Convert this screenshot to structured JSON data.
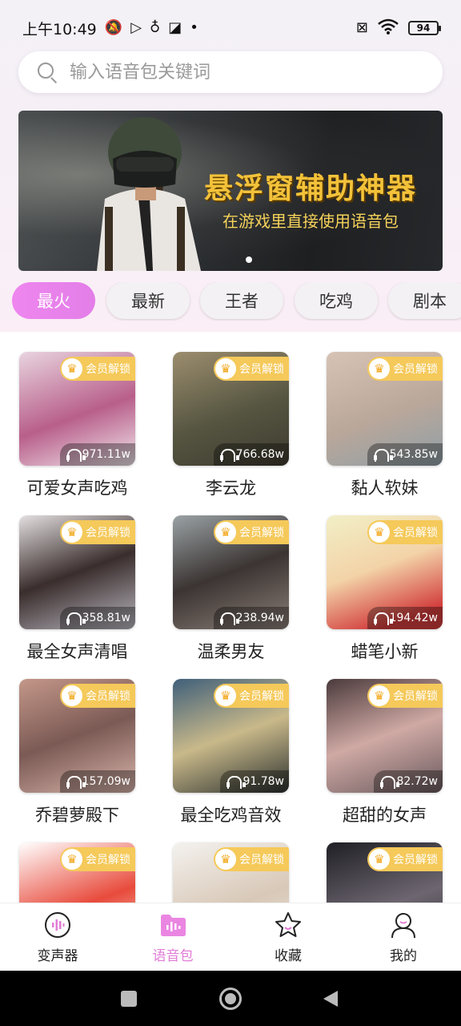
{
  "status_bar": {
    "time": "上午10:49",
    "battery": "94"
  },
  "search": {
    "placeholder": "输入语音包关键词"
  },
  "banner": {
    "title": "悬浮窗辅助神器",
    "subtitle": "在游戏里直接使用语音包"
  },
  "tabs": [
    {
      "label": "最火",
      "active": true
    },
    {
      "label": "最新"
    },
    {
      "label": "王者"
    },
    {
      "label": "吃鸡"
    },
    {
      "label": "剧本"
    }
  ],
  "badge_label": "会员解锁",
  "items": [
    {
      "title": "可爱女声吃鸡",
      "plays": "971.11w",
      "bg": "#d9a4b8"
    },
    {
      "title": "李云龙",
      "plays": "766.68w",
      "bg": "#6b6a55"
    },
    {
      "title": "黏人软妹",
      "plays": "543.85w",
      "bg": "#cdbab0"
    },
    {
      "title": "最全女声清唱",
      "plays": "358.81w",
      "bg": "#c9c4c6"
    },
    {
      "title": "温柔男友",
      "plays": "238.94w",
      "bg": "#8a8580"
    },
    {
      "title": "蜡笔小新",
      "plays": "194.42w",
      "bg": "#e9e5b5"
    },
    {
      "title": "乔碧萝殿下",
      "plays": "157.09w",
      "bg": "#b48b80"
    },
    {
      "title": "最全吃鸡音效",
      "plays": "91.78w",
      "bg": "#4e5a4a"
    },
    {
      "title": "超甜的女声",
      "plays": "82.72w",
      "bg": "#8f7a78"
    },
    {
      "title": "",
      "plays": "",
      "bg": "#e65a4a"
    },
    {
      "title": "",
      "plays": "",
      "bg": "#d9d1c7"
    },
    {
      "title": "",
      "plays": "",
      "bg": "#2a2a2e"
    }
  ],
  "bottom_nav": [
    {
      "label": "变声器",
      "icon": "voice-changer-icon"
    },
    {
      "label": "语音包",
      "icon": "voice-pack-icon",
      "active": true
    },
    {
      "label": "收藏",
      "icon": "star-icon"
    },
    {
      "label": "我的",
      "icon": "user-icon"
    }
  ],
  "colors": {
    "accent": "#e27cd6",
    "badge": "#f5c95a",
    "banner_text": "#f3c23a"
  }
}
